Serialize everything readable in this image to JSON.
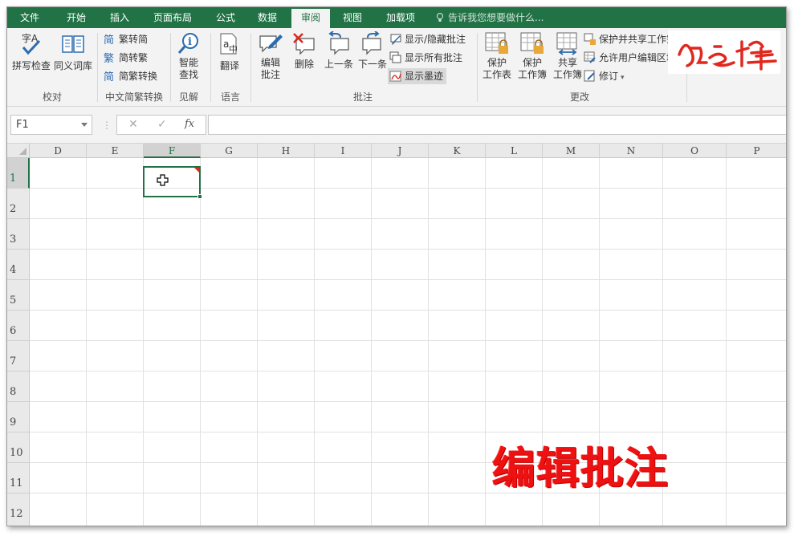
{
  "tabs": [
    "文件",
    "开始",
    "插入",
    "页面布局",
    "公式",
    "数据",
    "审阅",
    "视图",
    "加载项"
  ],
  "active_tab": "审阅",
  "tell_me": "告诉我您想要做什么...",
  "ribbon": {
    "proofing": {
      "spelling": "拼写检查",
      "thesaurus": "同义词库",
      "label": "校对"
    },
    "chinese_conversion": {
      "to_simplified": "繁转简",
      "to_traditional": "简转繁",
      "convert": "简繁转换",
      "label": "中文简繁转换"
    },
    "insights": {
      "smart_lookup_1": "智能",
      "smart_lookup_2": "查找",
      "label": "见解"
    },
    "language": {
      "translate": "翻译",
      "label": "语言"
    },
    "comments": {
      "edit_1": "编辑",
      "edit_2": "批注",
      "delete": "删除",
      "previous": "上一条",
      "next": "下一条",
      "show_hide": "显示/隐藏批注",
      "show_all": "显示所有批注",
      "show_ink": "显示墨迹",
      "label": "批注"
    },
    "changes": {
      "protect_sheet_1": "保护",
      "protect_sheet_2": "工作表",
      "protect_workbook_1": "保护",
      "protect_workbook_2": "工作簿",
      "share_workbook_1": "共享",
      "share_workbook_2": "工作簿",
      "protect_share": "保护并共享工作簿",
      "allow_edit_ranges": "允许用户编辑区域",
      "track_changes": "修订",
      "label": "更改"
    }
  },
  "formula_bar": {
    "name_box": "F1",
    "cancel": "✕",
    "enter": "✓",
    "fx": "fx",
    "content": ""
  },
  "columns": [
    "D",
    "E",
    "F",
    "G",
    "H",
    "I",
    "J",
    "K",
    "L",
    "M",
    "N",
    "O",
    "P"
  ],
  "rows": [
    "1",
    "2",
    "3",
    "4",
    "5",
    "6",
    "7",
    "8",
    "9",
    "10",
    "11",
    "12"
  ],
  "selected_cell": "F1",
  "overlay_caption": "编辑批注",
  "colors": {
    "accent": "#217346",
    "comment_marker": "#e0281e",
    "caption": "#ee1111"
  }
}
